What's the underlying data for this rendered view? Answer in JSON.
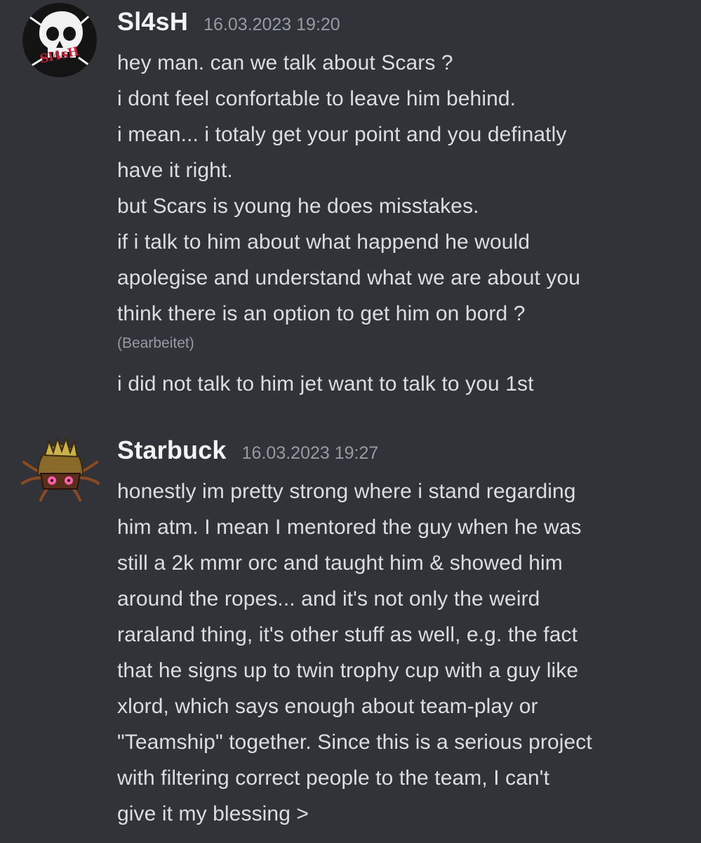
{
  "messages": [
    {
      "author": "Sl4sH",
      "timestamp": "16.03.2023 19:20",
      "lines": [
        "hey man. can we talk about Scars ?",
        "i dont feel confortable to leave him behind.",
        "i mean... i totaly get your point and you definatly",
        "have it right.",
        "but Scars is young he does misstakes.",
        "if i talk to him about what happend he would",
        "apolegise and understand what we are about you",
        "think there is an option to get him on bord ?"
      ],
      "edited_label": "(Bearbeitet)",
      "followup": "i did not talk to him jet want to talk to you 1st",
      "avatar": {
        "icon": "skull-avatar-icon",
        "text": "Sl4sH",
        "colors": {
          "bg": "#141414",
          "skull": "#f2f2f2",
          "text": "#c9233a"
        }
      }
    },
    {
      "author": "Starbuck",
      "timestamp": "16.03.2023 19:27",
      "lines": [
        "honestly im pretty strong where i stand regarding",
        "him atm. I mean I mentored the guy when he was",
        "still a 2k mmr orc and taught him & showed him",
        "around the ropes... and it's not only the weird",
        "raraland thing, it's other stuff as well, e.g. the fact",
        "that he signs up to twin trophy cup with a guy like",
        "xlord, which says enough about team-play or",
        "\"Teamship\" together. Since this is a serious project",
        "with filtering correct people to the team, I can't",
        "give it my blessing >"
      ],
      "avatar": {
        "icon": "kabuto-creature-avatar-icon",
        "colors": {
          "shell": "#8a6a2a",
          "spikes": "#c9b24a",
          "eyes": "#ff5fa8"
        }
      }
    }
  ],
  "theme": {
    "background": "#313338",
    "text": "#dbdee1",
    "muted": "#949ba4",
    "username": "#f2f3f5"
  }
}
